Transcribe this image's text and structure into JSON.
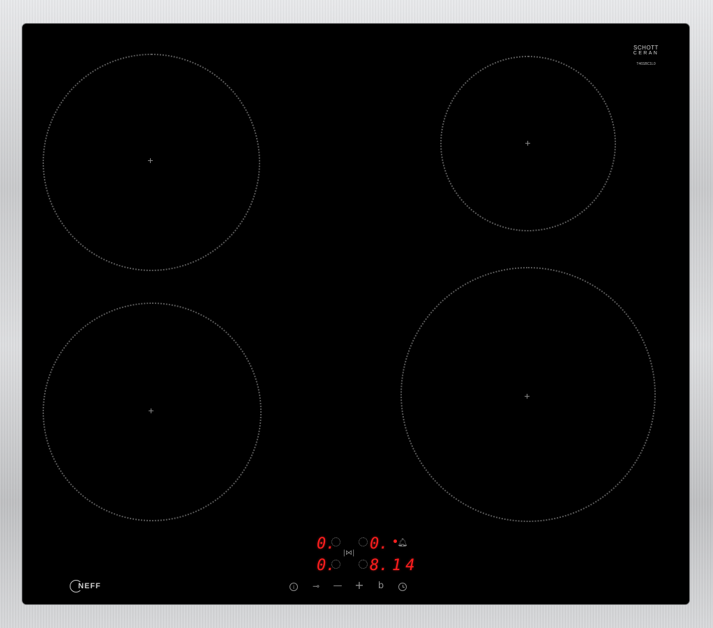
{
  "brand": {
    "glass_maker_line1": "SCHOTT",
    "glass_maker_line2": "CERAN",
    "model_code": "T46SBC1L0",
    "serial_small": "",
    "appliance_brand": "NEFF"
  },
  "display": {
    "zone_rear_left_level": "0.",
    "zone_rear_right_level": "0.",
    "zone_front_left_level": "0.",
    "zone_front_right_level": "8.",
    "timer_value": "14"
  },
  "controls": {
    "power_icon": "info-circle-icon",
    "lock_icon": "key-icon",
    "minus_label": "—",
    "plus_label": "+",
    "boost_label": "b",
    "timer_icon": "clock-icon",
    "bell_icon": "bell-icon",
    "sync_label": "|⋈|"
  },
  "colors": {
    "glass": "#000000",
    "display_red": "#ff1e1e",
    "frame_steel": "#cfd0d2"
  }
}
